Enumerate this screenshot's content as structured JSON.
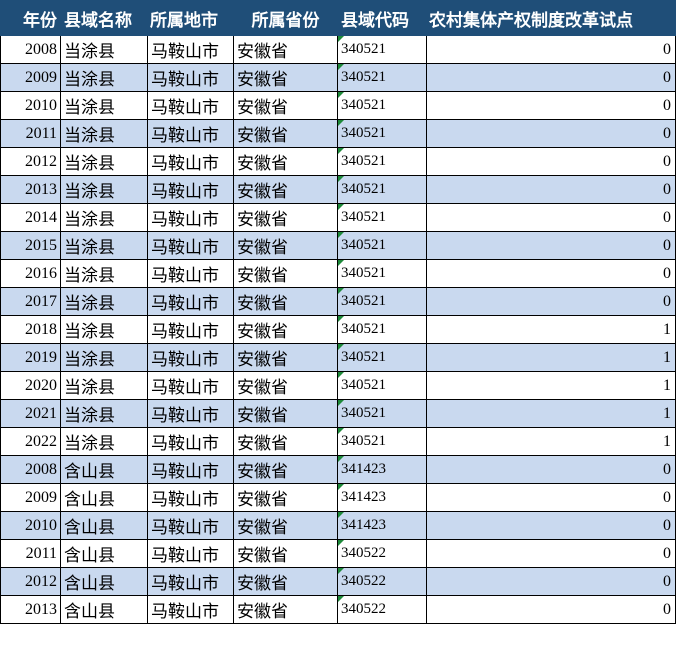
{
  "headers": {
    "year": "年份",
    "county": "县域名称",
    "city": "所属地市",
    "province": "所属省份",
    "code": "县域代码",
    "pilot": "农村集体产权制度改革试点"
  },
  "colors": {
    "header_bg": "#1f4e78",
    "header_text": "#ffffff",
    "alt_row": "#c9d9ef",
    "text_flag": "#1e8a3a"
  },
  "rows": [
    {
      "year": "2008",
      "county": "当涂县",
      "city": "马鞍山市",
      "province": "安徽省",
      "code": "340521",
      "pilot": "0"
    },
    {
      "year": "2009",
      "county": "当涂县",
      "city": "马鞍山市",
      "province": "安徽省",
      "code": "340521",
      "pilot": "0"
    },
    {
      "year": "2010",
      "county": "当涂县",
      "city": "马鞍山市",
      "province": "安徽省",
      "code": "340521",
      "pilot": "0"
    },
    {
      "year": "2011",
      "county": "当涂县",
      "city": "马鞍山市",
      "province": "安徽省",
      "code": "340521",
      "pilot": "0"
    },
    {
      "year": "2012",
      "county": "当涂县",
      "city": "马鞍山市",
      "province": "安徽省",
      "code": "340521",
      "pilot": "0"
    },
    {
      "year": "2013",
      "county": "当涂县",
      "city": "马鞍山市",
      "province": "安徽省",
      "code": "340521",
      "pilot": "0"
    },
    {
      "year": "2014",
      "county": "当涂县",
      "city": "马鞍山市",
      "province": "安徽省",
      "code": "340521",
      "pilot": "0"
    },
    {
      "year": "2015",
      "county": "当涂县",
      "city": "马鞍山市",
      "province": "安徽省",
      "code": "340521",
      "pilot": "0"
    },
    {
      "year": "2016",
      "county": "当涂县",
      "city": "马鞍山市",
      "province": "安徽省",
      "code": "340521",
      "pilot": "0"
    },
    {
      "year": "2017",
      "county": "当涂县",
      "city": "马鞍山市",
      "province": "安徽省",
      "code": "340521",
      "pilot": "0"
    },
    {
      "year": "2018",
      "county": "当涂县",
      "city": "马鞍山市",
      "province": "安徽省",
      "code": "340521",
      "pilot": "1"
    },
    {
      "year": "2019",
      "county": "当涂县",
      "city": "马鞍山市",
      "province": "安徽省",
      "code": "340521",
      "pilot": "1"
    },
    {
      "year": "2020",
      "county": "当涂县",
      "city": "马鞍山市",
      "province": "安徽省",
      "code": "340521",
      "pilot": "1"
    },
    {
      "year": "2021",
      "county": "当涂县",
      "city": "马鞍山市",
      "province": "安徽省",
      "code": "340521",
      "pilot": "1"
    },
    {
      "year": "2022",
      "county": "当涂县",
      "city": "马鞍山市",
      "province": "安徽省",
      "code": "340521",
      "pilot": "1"
    },
    {
      "year": "2008",
      "county": "含山县",
      "city": "马鞍山市",
      "province": "安徽省",
      "code": "341423",
      "pilot": "0"
    },
    {
      "year": "2009",
      "county": "含山县",
      "city": "马鞍山市",
      "province": "安徽省",
      "code": "341423",
      "pilot": "0"
    },
    {
      "year": "2010",
      "county": "含山县",
      "city": "马鞍山市",
      "province": "安徽省",
      "code": "341423",
      "pilot": "0"
    },
    {
      "year": "2011",
      "county": "含山县",
      "city": "马鞍山市",
      "province": "安徽省",
      "code": "340522",
      "pilot": "0"
    },
    {
      "year": "2012",
      "county": "含山县",
      "city": "马鞍山市",
      "province": "安徽省",
      "code": "340522",
      "pilot": "0"
    },
    {
      "year": "2013",
      "county": "含山县",
      "city": "马鞍山市",
      "province": "安徽省",
      "code": "340522",
      "pilot": "0"
    }
  ]
}
